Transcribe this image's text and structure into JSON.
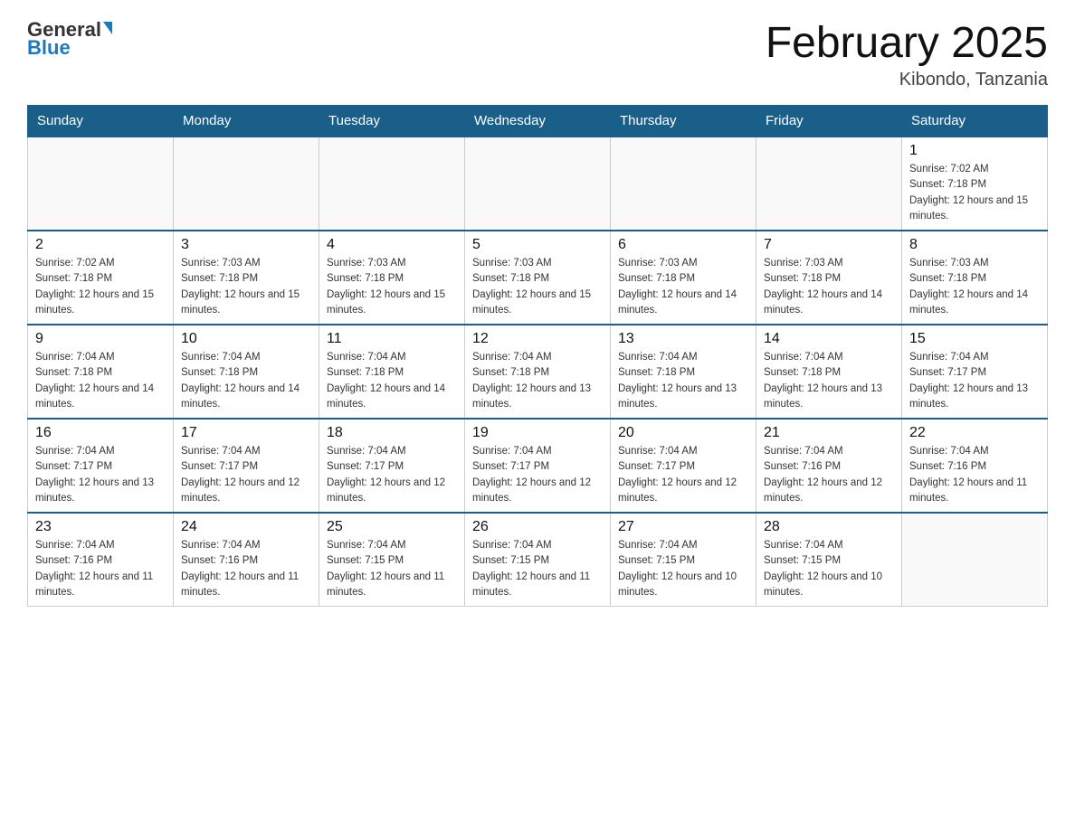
{
  "header": {
    "logo_general": "General",
    "logo_blue": "Blue",
    "title": "February 2025",
    "location": "Kibondo, Tanzania"
  },
  "days_of_week": [
    "Sunday",
    "Monday",
    "Tuesday",
    "Wednesday",
    "Thursday",
    "Friday",
    "Saturday"
  ],
  "weeks": [
    [
      {
        "day": "",
        "info": ""
      },
      {
        "day": "",
        "info": ""
      },
      {
        "day": "",
        "info": ""
      },
      {
        "day": "",
        "info": ""
      },
      {
        "day": "",
        "info": ""
      },
      {
        "day": "",
        "info": ""
      },
      {
        "day": "1",
        "info": "Sunrise: 7:02 AM\nSunset: 7:18 PM\nDaylight: 12 hours and 15 minutes."
      }
    ],
    [
      {
        "day": "2",
        "info": "Sunrise: 7:02 AM\nSunset: 7:18 PM\nDaylight: 12 hours and 15 minutes."
      },
      {
        "day": "3",
        "info": "Sunrise: 7:03 AM\nSunset: 7:18 PM\nDaylight: 12 hours and 15 minutes."
      },
      {
        "day": "4",
        "info": "Sunrise: 7:03 AM\nSunset: 7:18 PM\nDaylight: 12 hours and 15 minutes."
      },
      {
        "day": "5",
        "info": "Sunrise: 7:03 AM\nSunset: 7:18 PM\nDaylight: 12 hours and 15 minutes."
      },
      {
        "day": "6",
        "info": "Sunrise: 7:03 AM\nSunset: 7:18 PM\nDaylight: 12 hours and 14 minutes."
      },
      {
        "day": "7",
        "info": "Sunrise: 7:03 AM\nSunset: 7:18 PM\nDaylight: 12 hours and 14 minutes."
      },
      {
        "day": "8",
        "info": "Sunrise: 7:03 AM\nSunset: 7:18 PM\nDaylight: 12 hours and 14 minutes."
      }
    ],
    [
      {
        "day": "9",
        "info": "Sunrise: 7:04 AM\nSunset: 7:18 PM\nDaylight: 12 hours and 14 minutes."
      },
      {
        "day": "10",
        "info": "Sunrise: 7:04 AM\nSunset: 7:18 PM\nDaylight: 12 hours and 14 minutes."
      },
      {
        "day": "11",
        "info": "Sunrise: 7:04 AM\nSunset: 7:18 PM\nDaylight: 12 hours and 14 minutes."
      },
      {
        "day": "12",
        "info": "Sunrise: 7:04 AM\nSunset: 7:18 PM\nDaylight: 12 hours and 13 minutes."
      },
      {
        "day": "13",
        "info": "Sunrise: 7:04 AM\nSunset: 7:18 PM\nDaylight: 12 hours and 13 minutes."
      },
      {
        "day": "14",
        "info": "Sunrise: 7:04 AM\nSunset: 7:18 PM\nDaylight: 12 hours and 13 minutes."
      },
      {
        "day": "15",
        "info": "Sunrise: 7:04 AM\nSunset: 7:17 PM\nDaylight: 12 hours and 13 minutes."
      }
    ],
    [
      {
        "day": "16",
        "info": "Sunrise: 7:04 AM\nSunset: 7:17 PM\nDaylight: 12 hours and 13 minutes."
      },
      {
        "day": "17",
        "info": "Sunrise: 7:04 AM\nSunset: 7:17 PM\nDaylight: 12 hours and 12 minutes."
      },
      {
        "day": "18",
        "info": "Sunrise: 7:04 AM\nSunset: 7:17 PM\nDaylight: 12 hours and 12 minutes."
      },
      {
        "day": "19",
        "info": "Sunrise: 7:04 AM\nSunset: 7:17 PM\nDaylight: 12 hours and 12 minutes."
      },
      {
        "day": "20",
        "info": "Sunrise: 7:04 AM\nSunset: 7:17 PM\nDaylight: 12 hours and 12 minutes."
      },
      {
        "day": "21",
        "info": "Sunrise: 7:04 AM\nSunset: 7:16 PM\nDaylight: 12 hours and 12 minutes."
      },
      {
        "day": "22",
        "info": "Sunrise: 7:04 AM\nSunset: 7:16 PM\nDaylight: 12 hours and 11 minutes."
      }
    ],
    [
      {
        "day": "23",
        "info": "Sunrise: 7:04 AM\nSunset: 7:16 PM\nDaylight: 12 hours and 11 minutes."
      },
      {
        "day": "24",
        "info": "Sunrise: 7:04 AM\nSunset: 7:16 PM\nDaylight: 12 hours and 11 minutes."
      },
      {
        "day": "25",
        "info": "Sunrise: 7:04 AM\nSunset: 7:15 PM\nDaylight: 12 hours and 11 minutes."
      },
      {
        "day": "26",
        "info": "Sunrise: 7:04 AM\nSunset: 7:15 PM\nDaylight: 12 hours and 11 minutes."
      },
      {
        "day": "27",
        "info": "Sunrise: 7:04 AM\nSunset: 7:15 PM\nDaylight: 12 hours and 10 minutes."
      },
      {
        "day": "28",
        "info": "Sunrise: 7:04 AM\nSunset: 7:15 PM\nDaylight: 12 hours and 10 minutes."
      },
      {
        "day": "",
        "info": ""
      }
    ]
  ]
}
